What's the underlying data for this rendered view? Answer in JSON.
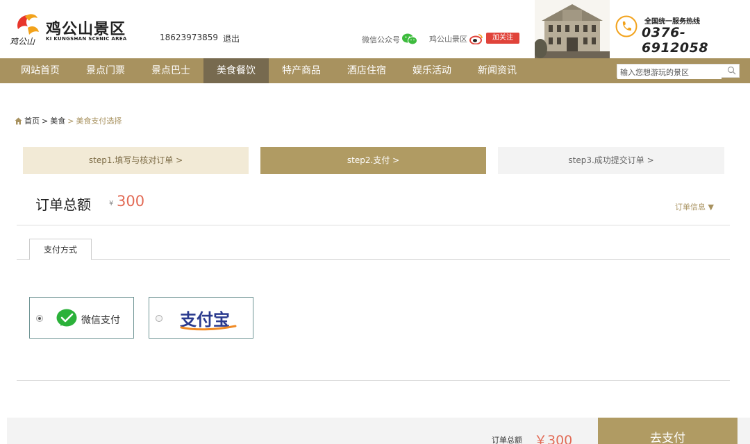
{
  "header": {
    "logo_cn": "鸡公山景区",
    "logo_en": "KI KUNGSHAN SCENIC AREA",
    "user_phone": "18623973859",
    "logout": "退出",
    "wechat_label": "微信公众号",
    "weibo_label": "鸡公山景区",
    "follow_label": "加关注",
    "hotline_label": "全国统一服务热线",
    "hotline_number": "0376-6912058"
  },
  "nav": {
    "items": [
      {
        "label": "网站首页"
      },
      {
        "label": "景点门票"
      },
      {
        "label": "景点巴士"
      },
      {
        "label": "美食餐饮"
      },
      {
        "label": "特产商品"
      },
      {
        "label": "酒店住宿"
      },
      {
        "label": "娱乐活动"
      },
      {
        "label": "新闻资讯"
      }
    ],
    "active_index": 3,
    "search_placeholder": "输入您想游玩的景区"
  },
  "breadcrumb": {
    "home": "首页",
    "sep1": ">",
    "level2": "美食",
    "sep2": ">",
    "current": "美食支付选择"
  },
  "steps": [
    {
      "label": "step1.填写与核对订单 >"
    },
    {
      "label": "step2.支付 >"
    },
    {
      "label": "step3.成功提交订单 >"
    }
  ],
  "order": {
    "total_label": "订单总额",
    "currency": "¥",
    "total_amount": "300",
    "info_link": "订单信息 ▼"
  },
  "payment": {
    "tab_label": "支付方式",
    "wechat_label": "微信支付",
    "alipay_label": "支付宝",
    "selected": "wechat"
  },
  "footer": {
    "total_label": "订单总额",
    "total_amount": "￥300",
    "pay_button": "去支付"
  },
  "colors": {
    "nav_bg": "#a8925f",
    "nav_active": "#776a4f",
    "accent_gold": "#b09b63",
    "price_red": "#e26b56",
    "follow_red": "#e0433a"
  }
}
